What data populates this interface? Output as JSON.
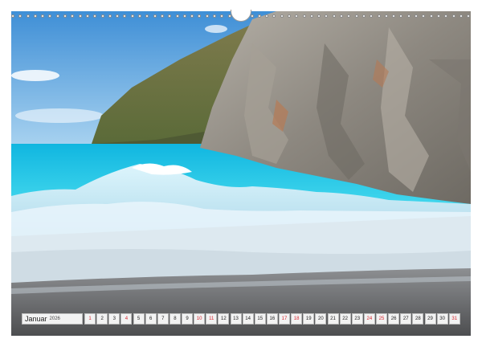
{
  "calendar": {
    "month": "Januar",
    "year": "2026",
    "days": [
      "1",
      "2",
      "3",
      "4",
      "5",
      "6",
      "7",
      "8",
      "9",
      "10",
      "11",
      "12",
      "13",
      "14",
      "15",
      "16",
      "17",
      "18",
      "19",
      "20",
      "21",
      "22",
      "23",
      "24",
      "25",
      "26",
      "27",
      "28",
      "29",
      "30",
      "31"
    ],
    "red_days": [
      "1",
      "4",
      "10",
      "11",
      "17",
      "18",
      "24",
      "25",
      "31"
    ]
  },
  "colors": {
    "sunday_red": "#d8262f",
    "sea_turquoise": "#22c7e6",
    "sky_blue": "#5aa2dc",
    "rock_grey": "#9c9890"
  }
}
